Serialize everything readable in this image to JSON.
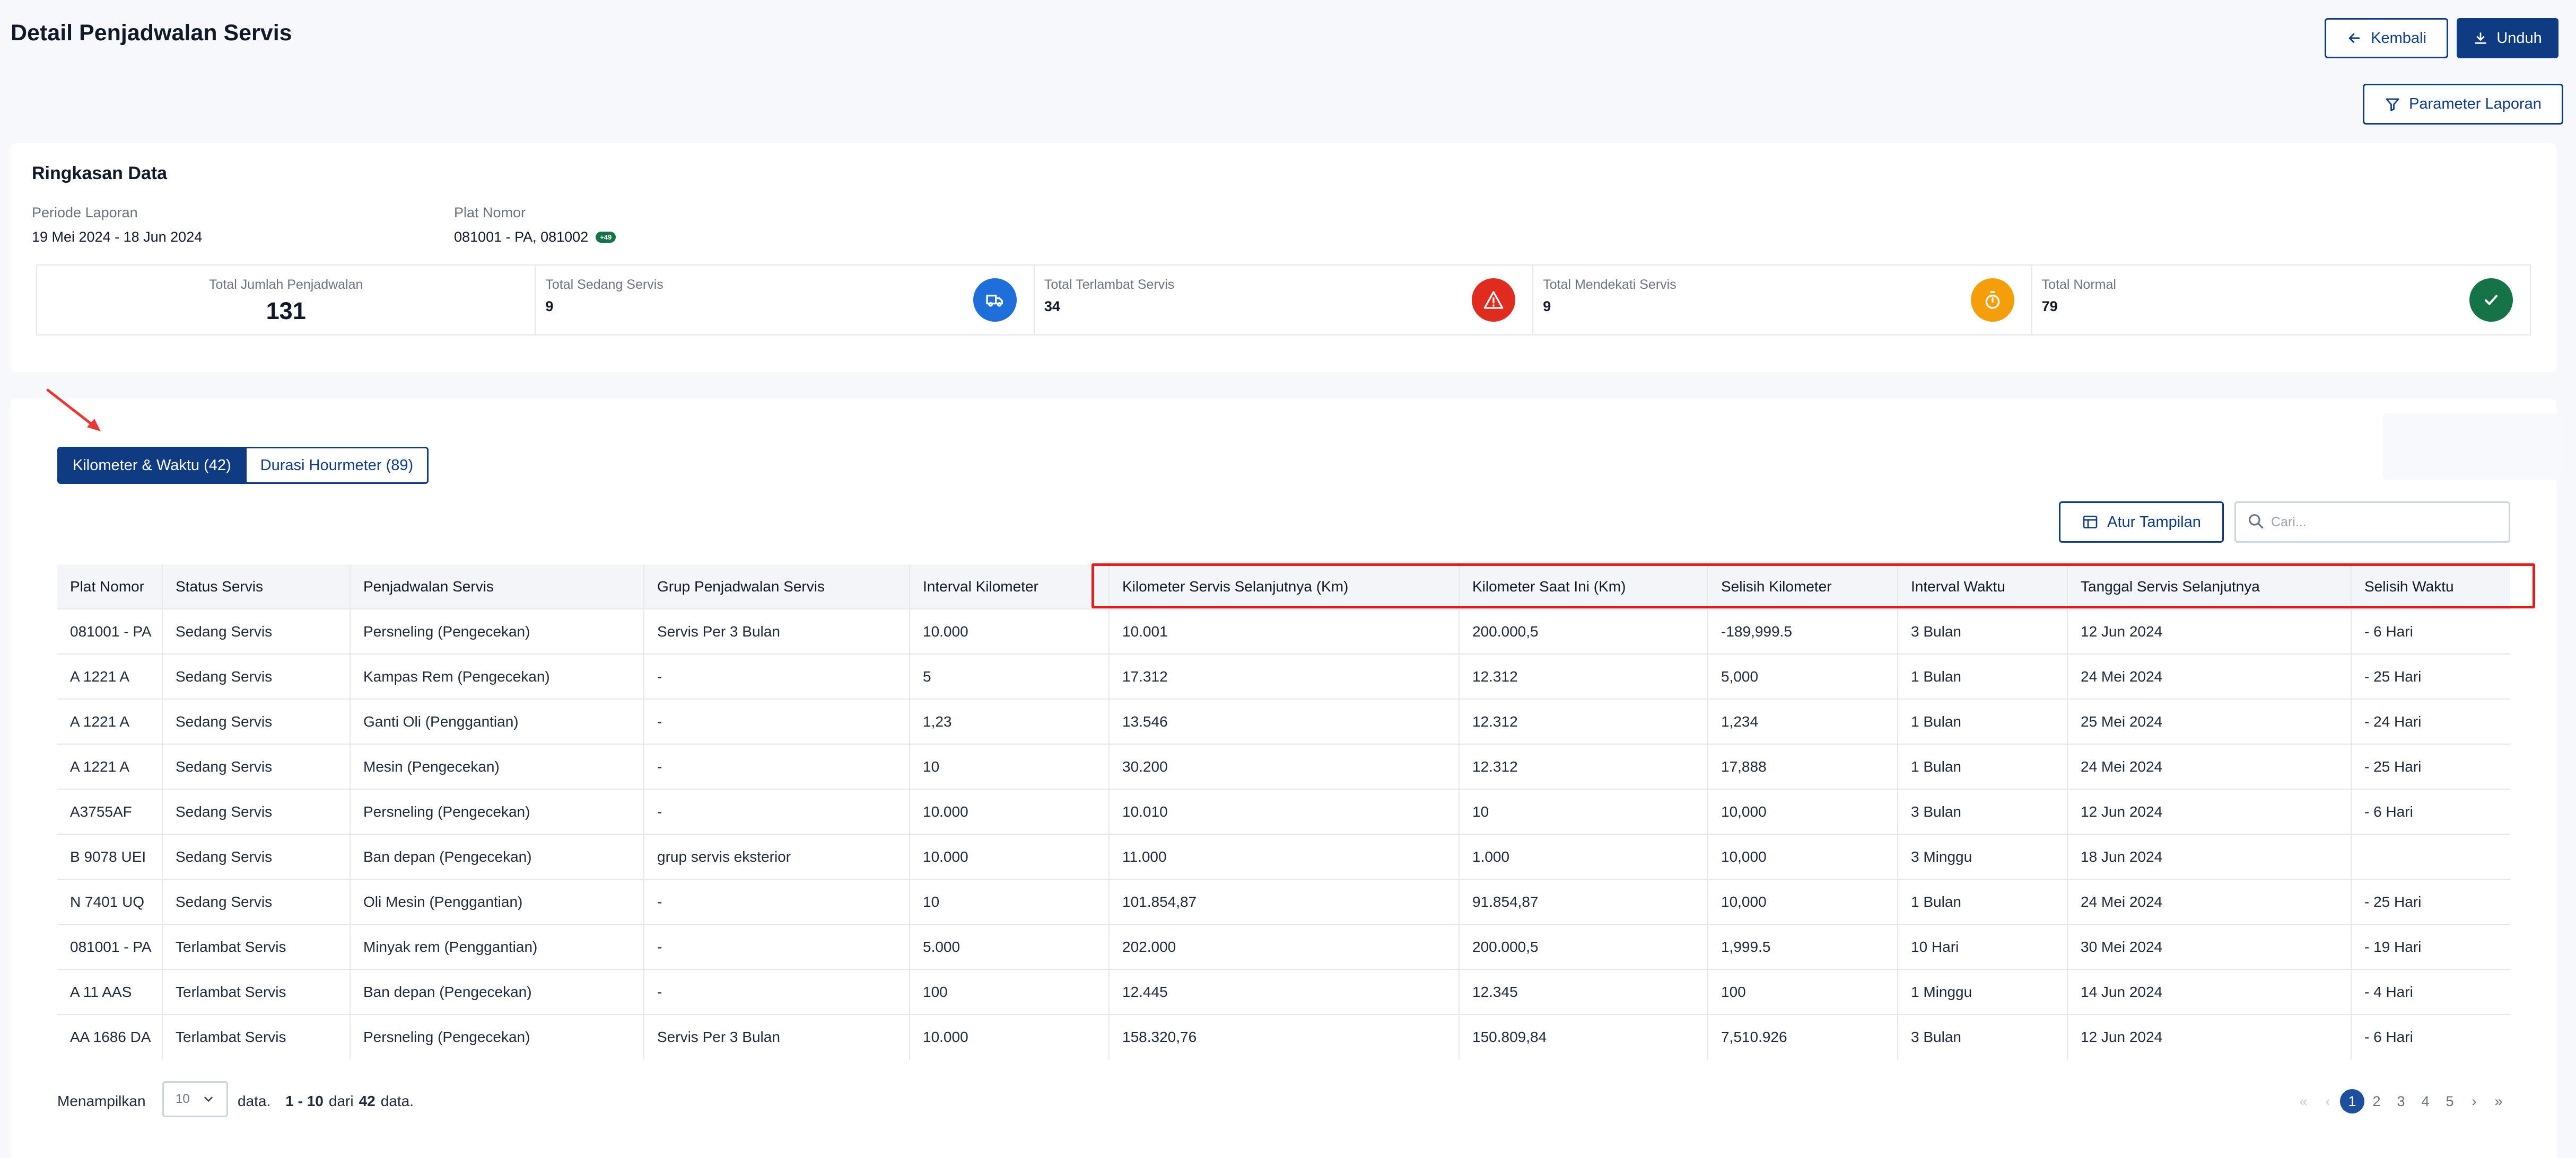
{
  "header": {
    "title": "Detail Penjadwalan Servis",
    "back_label": "Kembali",
    "download_label": "Unduh",
    "params_label": "Parameter Laporan"
  },
  "summary": {
    "title": "Ringkasan Data",
    "period_label": "Periode Laporan",
    "period_value": "19 Mei 2024 - 18 Jun 2024",
    "plate_label": "Plat Nomor",
    "plate_value": "081001 - PA, 081002",
    "plate_more": "+49",
    "stats": [
      {
        "label": "Total Jumlah Penjadwalan",
        "value": "131"
      },
      {
        "label": "Total Sedang Servis",
        "value": "9",
        "icon": "truck-service-icon",
        "color": "#1e6fd9"
      },
      {
        "label": "Total Terlambat Servis",
        "value": "34",
        "icon": "warning-icon",
        "color": "#e02b20"
      },
      {
        "label": "Total Mendekati Servis",
        "value": "9",
        "icon": "stopwatch-icon",
        "color": "#f59e0b"
      },
      {
        "label": "Total Normal",
        "value": "79",
        "icon": "check-icon",
        "color": "#157347"
      }
    ]
  },
  "tabs": [
    {
      "label": "Kilometer & Waktu (42)",
      "active": true
    },
    {
      "label": "Durasi Hourmeter (89)",
      "active": false
    }
  ],
  "toolbar": {
    "layout_label": "Atur Tampilan",
    "search_placeholder": "Cari..."
  },
  "table": {
    "columns": [
      "Plat Nomor",
      "Status Servis",
      "Penjadwalan Servis",
      "Grup Penjadwalan Servis",
      "Interval Kilometer",
      "Kilometer Servis Selanjutnya (Km)",
      "Kilometer Saat Ini (Km)",
      "Selisih Kilometer",
      "Interval Waktu",
      "Tanggal Servis Selanjutnya",
      "Selisih Waktu"
    ],
    "rows": [
      [
        "081001 - PA",
        "Sedang Servis",
        "Persneling (Pengecekan)",
        "Servis Per 3 Bulan",
        "10.000",
        "10.001",
        "200.000,5",
        "-189,999.5",
        "3 Bulan",
        "12 Jun 2024",
        "- 6 Hari"
      ],
      [
        "A 1221 A",
        "Sedang Servis",
        "Kampas Rem (Pengecekan)",
        "-",
        "5",
        "17.312",
        "12.312",
        "5,000",
        "1 Bulan",
        "24 Mei 2024",
        "- 25 Hari"
      ],
      [
        "A 1221 A",
        "Sedang Servis",
        "Ganti Oli (Penggantian)",
        "-",
        "1,23",
        "13.546",
        "12.312",
        "1,234",
        "1 Bulan",
        "25 Mei 2024",
        "- 24 Hari"
      ],
      [
        "A 1221 A",
        "Sedang Servis",
        "Mesin (Pengecekan)",
        "-",
        "10",
        "30.200",
        "12.312",
        "17,888",
        "1 Bulan",
        "24 Mei 2024",
        "- 25 Hari"
      ],
      [
        "A3755AF",
        "Sedang Servis",
        "Persneling (Pengecekan)",
        "-",
        "10.000",
        "10.010",
        "10",
        "10,000",
        "3 Bulan",
        "12 Jun 2024",
        "- 6 Hari"
      ],
      [
        "B 9078 UEI",
        "Sedang Servis",
        "Ban depan (Pengecekan)",
        "grup servis eksterior",
        "10.000",
        "11.000",
        "1.000",
        "10,000",
        "3 Minggu",
        "18 Jun 2024",
        ""
      ],
      [
        "N 7401 UQ",
        "Sedang Servis",
        "Oli Mesin (Penggantian)",
        "-",
        "10",
        "101.854,87",
        "91.854,87",
        "10,000",
        "1 Bulan",
        "24 Mei 2024",
        "- 25 Hari"
      ],
      [
        "081001 - PA",
        "Terlambat Servis",
        "Minyak rem (Penggantian)",
        "-",
        "5.000",
        "202.000",
        "200.000,5",
        "1,999.5",
        "10 Hari",
        "30 Mei 2024",
        "- 19 Hari"
      ],
      [
        "A 11 AAS",
        "Terlambat Servis",
        "Ban depan (Pengecekan)",
        "-",
        "100",
        "12.445",
        "12.345",
        "100",
        "1 Minggu",
        "14 Jun 2024",
        "- 4 Hari"
      ],
      [
        "AA 1686 DA",
        "Terlambat Servis",
        "Persneling (Pengecekan)",
        "Servis Per 3 Bulan",
        "10.000",
        "158.320,76",
        "150.809,84",
        "7,510.926",
        "3 Bulan",
        "12 Jun 2024",
        "- 6 Hari"
      ]
    ]
  },
  "footer": {
    "showing_label": "Menampilkan",
    "per_page": "10",
    "data_label": "data.",
    "range": "1 - 10",
    "of_label": "dari",
    "total": "42",
    "data_end": "data.",
    "pages": [
      "1",
      "2",
      "3",
      "4",
      "5"
    ],
    "current_page": "1",
    "first": "«",
    "prev": "‹",
    "next": "›",
    "last": "»"
  }
}
